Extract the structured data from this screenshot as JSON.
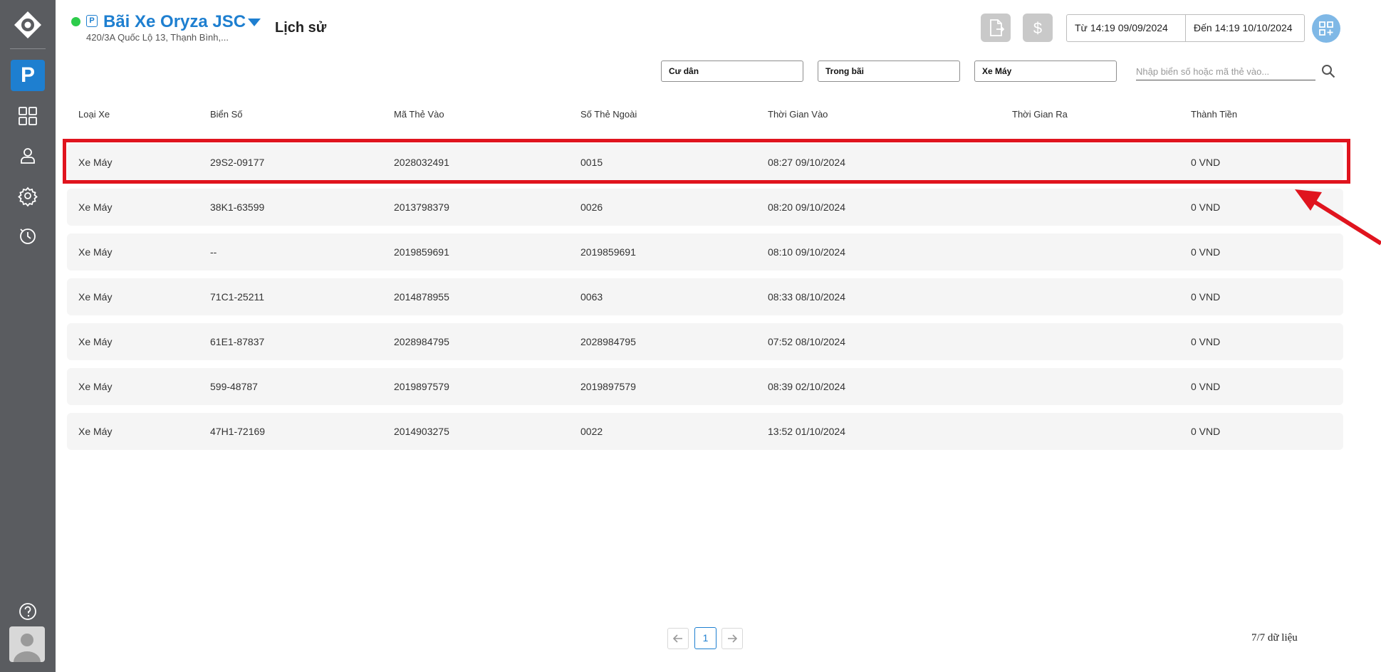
{
  "header": {
    "lot_name": "Bãi Xe Oryza JSC",
    "lot_address": "420/3A Quốc Lộ 13, Thạnh Bình,...",
    "page_title": "Lịch sử",
    "parking_badge": "P",
    "date_from": "Từ 14:19 09/09/2024",
    "date_to": "Đến 14:19 10/10/2024"
  },
  "sidebar": {
    "active_label": "P",
    "items": [
      "grid-icon",
      "user-icon",
      "gear-icon",
      "history-icon"
    ]
  },
  "filters": {
    "resident": "Cư dân",
    "location": "Trong bãi",
    "vehicle": "Xe Máy",
    "search_placeholder": "Nhập biển số hoặc mã thẻ vào..."
  },
  "table": {
    "columns": [
      "Loại Xe",
      "Biển Số",
      "Mã Thẻ Vào",
      "Số Thẻ Ngoài",
      "Thời Gian Vào",
      "Thời Gian Ra",
      "Thành Tiền"
    ],
    "rows": [
      [
        "Xe Máy",
        "29S2-09177",
        "2028032491",
        "0015",
        "08:27 09/10/2024",
        "",
        "0 VND"
      ],
      [
        "Xe Máy",
        "38K1-63599",
        "2013798379",
        "0026",
        "08:20 09/10/2024",
        "",
        "0 VND"
      ],
      [
        "Xe Máy",
        "--",
        "2019859691",
        "2019859691",
        "08:10 09/10/2024",
        "",
        "0 VND"
      ],
      [
        "Xe Máy",
        "71C1-25211",
        "2014878955",
        "0063",
        "08:33 08/10/2024",
        "",
        "0 VND"
      ],
      [
        "Xe Máy",
        "61E1-87837",
        "2028984795",
        "2028984795",
        "07:52 08/10/2024",
        "",
        "0 VND"
      ],
      [
        "Xe Máy",
        "599-48787",
        "2019897579",
        "2019897579",
        "08:39 02/10/2024",
        "",
        "0 VND"
      ],
      [
        "Xe Máy",
        "47H1-72169",
        "2014903275",
        "0022",
        "13:52 01/10/2024",
        "",
        "0 VND"
      ]
    ]
  },
  "pagination": {
    "current_page": "1",
    "total": "7/7 dữ liệu"
  },
  "colors": {
    "brand": "#1e7fd0",
    "sidebar": "#5a5c60",
    "online": "#2dcc4b",
    "annotation": "#e0141e"
  }
}
